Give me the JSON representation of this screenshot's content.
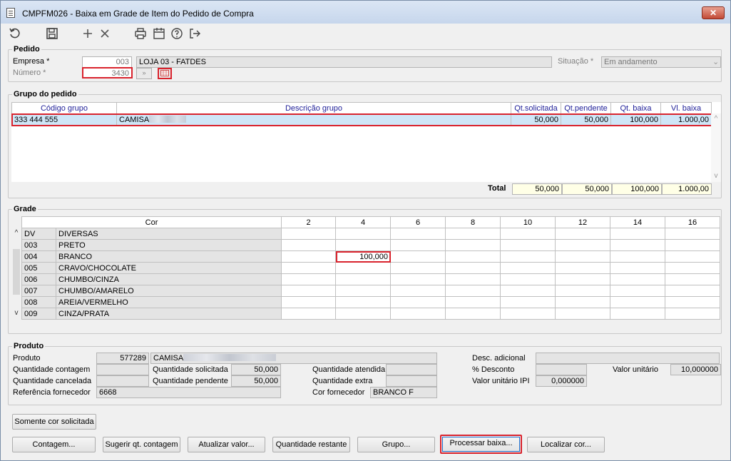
{
  "window": {
    "title": "CMPFM026 - Baixa em Grade de Item do Pedido de Compra",
    "close_glyph": "✕"
  },
  "toolbar": {
    "icons": [
      "refresh-icon",
      "save-icon",
      "add-icon",
      "delete-icon",
      "print-icon",
      "calendar-icon",
      "help-icon",
      "exit-icon"
    ]
  },
  "pedido": {
    "legend": "Pedido",
    "empresa_label": "Empresa *",
    "empresa_code": "003",
    "empresa_name": "LOJA 03 - FATDES",
    "numero_label": "Número *",
    "numero_value": "3430",
    "situacao_label": "Situação *",
    "situacao_value": "Em andamento"
  },
  "grupo": {
    "legend": "Grupo do pedido",
    "columns": [
      "Código grupo",
      "Descrição grupo",
      "Qt.solicitada",
      "Qt.pendente",
      "Qt. baixa",
      "Vl. baixa"
    ],
    "rows": [
      {
        "codigo": "333 444 555",
        "descricao": "CAMISA",
        "qt_solicitada": "50,000",
        "qt_pendente": "50,000",
        "qt_baixa": "100,000",
        "vl_baixa": "1.000,00"
      }
    ],
    "total_label": "Total",
    "totals": {
      "qt_solicitada": "50,000",
      "qt_pendente": "50,000",
      "qt_baixa": "100,000",
      "vl_baixa": "1.000,00"
    }
  },
  "grade": {
    "legend": "Grade",
    "cor_header": "Cor",
    "sizes": [
      "2",
      "4",
      "6",
      "8",
      "10",
      "12",
      "14",
      "16"
    ],
    "rows": [
      {
        "code": "DV",
        "name": "DIVERSAS"
      },
      {
        "code": "003",
        "name": "PRETO"
      },
      {
        "code": "004",
        "name": "BRANCO",
        "value_size_4": "100,000"
      },
      {
        "code": "005",
        "name": "CRAVO/CHOCOLATE"
      },
      {
        "code": "006",
        "name": "CHUMBO/CINZA"
      },
      {
        "code": "007",
        "name": "CHUMBO/AMARELO"
      },
      {
        "code": "008",
        "name": "AREIA/VERMELHO"
      },
      {
        "code": "009",
        "name": "CINZA/PRATA"
      }
    ]
  },
  "produto": {
    "legend": "Produto",
    "produto_label": "Produto",
    "produto_code": "577289",
    "produto_name": "CAMISA",
    "qt_contagem_label": "Quantidade contagem",
    "qt_cancelada_label": "Quantidade cancelada",
    "ref_fornecedor_label": "Referência fornecedor",
    "ref_fornecedor_value": "6668",
    "qt_solicitada_label": "Quantidade solicitada",
    "qt_solicitada_value": "50,000",
    "qt_pendente_label": "Quantidade pendente",
    "qt_pendente_value": "50,000",
    "qt_atendida_label": "Quantidade atendida",
    "qt_extra_label": "Quantidade extra",
    "cor_fornecedor_label": "Cor fornecedor",
    "cor_fornecedor_value": "BRANCO F",
    "desc_adicional_label": "Desc. adicional",
    "pct_desconto_label": "% Desconto",
    "valor_unitario_label": "Valor unitário",
    "valor_unitario_value": "10,000000",
    "valor_unitario_ipi_label": "Valor unitário IPI",
    "valor_unitario_ipi_value": "0,000000"
  },
  "buttons": {
    "somente_cor": "Somente cor solicitada",
    "contagem": "Contagem...",
    "sugerir": "Sugerir qt. contagem",
    "atualizar": "Atualizar valor...",
    "qt_restante": "Quantidade restante",
    "grupo": "Grupo...",
    "processar": "Processar baixa...",
    "localizar": "Localizar cor..."
  }
}
